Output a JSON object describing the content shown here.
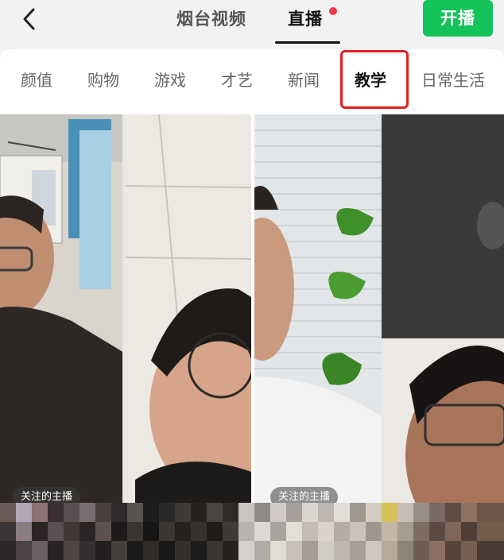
{
  "header": {
    "back_icon": "chevron-left-icon",
    "tabs": [
      {
        "label": "烟台视频"
      },
      {
        "label": "直播"
      }
    ],
    "go_live_label": "开播",
    "accent_color": "#14c25a",
    "badge_color": "#f0384a"
  },
  "categories": [
    {
      "label": "颜值"
    },
    {
      "label": "购物"
    },
    {
      "label": "游戏"
    },
    {
      "label": "才艺"
    },
    {
      "label": "新闻"
    },
    {
      "label": "教学"
    },
    {
      "label": "日常生活"
    }
  ],
  "active_category": "教学",
  "highlight_color": "#e32120",
  "streams": [
    {
      "badge": "关注的主播"
    },
    {
      "badge": "关注的主播"
    }
  ]
}
